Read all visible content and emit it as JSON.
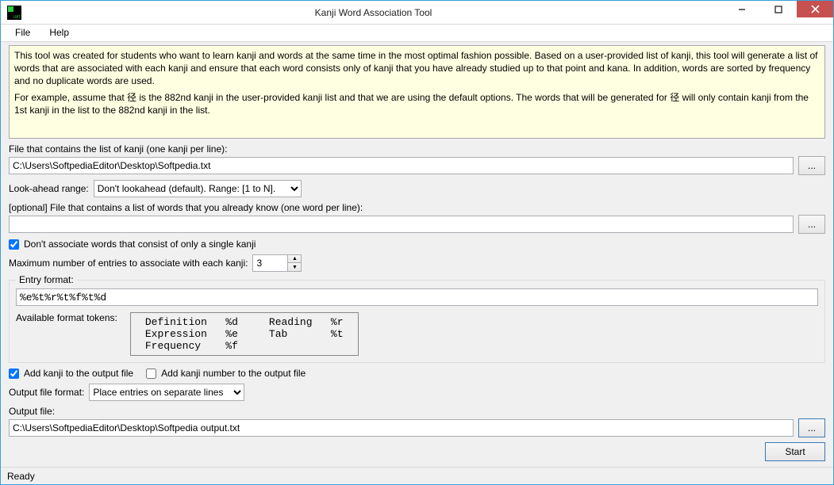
{
  "window": {
    "title": "Kanji Word Association Tool"
  },
  "menu": {
    "file": "File",
    "help": "Help"
  },
  "info": {
    "p1": "This tool was created for students who want to learn kanji and words at the same time in the most optimal fashion possible. Based on a user-provided list of kanji, this tool will generate a list of words that are associated with each kanji and ensure that each word consists only of kanji that you have already studied up to that point and kana. In addition, words are sorted by frequency and no duplicate words are used.",
    "p2": "For example, assume that 径 is the 882nd kanji in the user-provided kanji list and that we are using the default options. The words that will be generated for 径 will only contain kanji from the 1st kanji in the list to the 882nd kanji in the list."
  },
  "labels": {
    "kanji_file": "File that contains the list of kanji (one kanji per line):",
    "lookahead": "Look-ahead range:",
    "known_words": "[optional] File that contains a list of words that you already know (one word per line):",
    "dont_assoc_single": "Don't associate words that consist of only a single kanji",
    "max_entries": "Maximum number of entries to associate with each kanji:",
    "entry_format_group": "Entry format:",
    "available_tokens": "Available format tokens:",
    "add_kanji_output": "Add kanji to the output file",
    "add_kanji_number": "Add kanji number to the output file",
    "output_format": "Output file format:",
    "output_file": "Output file:"
  },
  "values": {
    "kanji_file_path": "C:\\Users\\SoftpediaEditor\\Desktop\\Softpedia.txt",
    "lookahead_sel": "Don't lookahead (default). Range: [1 to N].",
    "known_words_path": "",
    "max_entries_value": "3",
    "entry_format": "%e%t%r%t%f%t%d",
    "output_format_sel": "Place entries on separate lines",
    "output_file_path": "C:\\Users\\SoftpediaEditor\\Desktop\\Softpedia output.txt"
  },
  "tokens": [
    [
      "Definition",
      "%d",
      "Reading",
      "%r"
    ],
    [
      "Expression",
      "%e",
      "Tab",
      "%t"
    ],
    [
      "Frequency",
      "%f",
      "",
      ""
    ]
  ],
  "buttons": {
    "browse": "...",
    "start": "Start"
  },
  "status": "Ready"
}
